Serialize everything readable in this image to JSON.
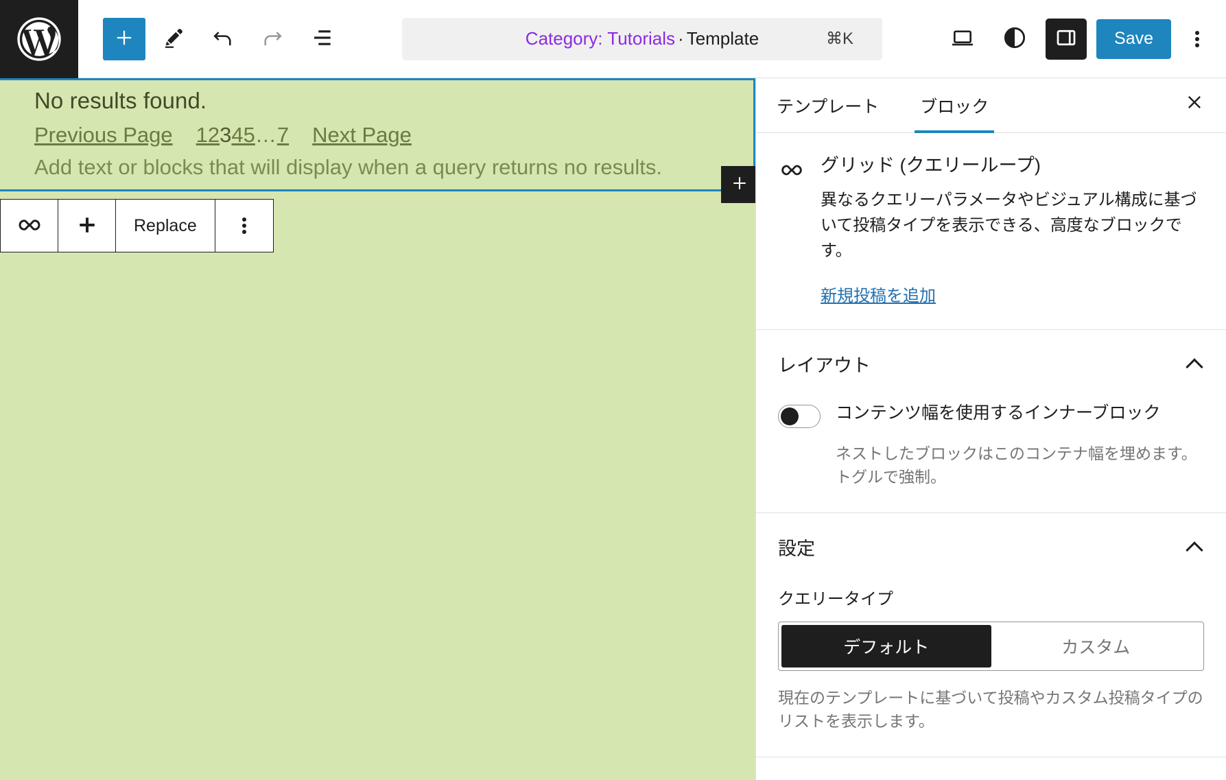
{
  "header": {
    "logo_icon": "wordpress-logo-icon",
    "add_block_icon": "plus-icon",
    "edit_icon": "pencil-icon",
    "undo_icon": "undo-arrow-icon",
    "redo_icon": "redo-arrow-icon",
    "list_view_icon": "list-view-icon",
    "document_title_category": "Category: Tutorials",
    "document_title_separator": "·",
    "document_title_type": "Template",
    "document_shortcut": "⌘K",
    "view_icon": "desktop-view-icon",
    "styles_icon": "contrast-styles-icon",
    "sidebar_toggle_icon": "sidebar-panel-icon",
    "save_label": "Save",
    "options_icon": "kebab-menu-icon"
  },
  "canvas": {
    "no_results_text": "No results found.",
    "pagination": {
      "previous_label": "Previous Page",
      "pages": [
        "1",
        "2",
        "3",
        "4",
        "5"
      ],
      "current_page": "3",
      "dots": "…",
      "last_page": "7",
      "next_label": "Next Page"
    },
    "no_results_placeholder": "Add text or blocks that will display when a query returns no results.",
    "appender_icon": "plus-icon",
    "block_toolbar": {
      "block_type_icon": "query-loop-icon",
      "add_icon": "plus-icon",
      "replace_label": "Replace",
      "options_icon": "kebab-menu-icon"
    }
  },
  "sidebar": {
    "tabs": [
      {
        "label": "テンプレート",
        "active": false
      },
      {
        "label": "ブロック",
        "active": true
      }
    ],
    "close_icon": "close-icon",
    "block_card": {
      "icon": "query-loop-icon",
      "title": "グリッド (クエリーループ)",
      "description": "異なるクエリーパラメータやビジュアル構成に基づいて投稿タイプを表示できる、高度なブロックです。",
      "link_label": "新規投稿を追加"
    },
    "layout_panel": {
      "title": "レイアウト",
      "chevron_icon": "chevron-up-icon",
      "toggle_label": "コンテンツ幅を使用するインナーブロック",
      "toggle_on": false,
      "help_text": "ネストしたブロックはこのコンテナ幅を埋めます。トグルで強制。"
    },
    "settings_panel": {
      "title": "設定",
      "chevron_icon": "chevron-up-icon",
      "query_type_label": "クエリータイプ",
      "query_type_options": [
        "デフォルト",
        "カスタム"
      ],
      "query_type_selected": "デフォルト",
      "help_text": "現在のテンプレートに基づいて投稿やカスタム投稿タイプのリストを表示します。"
    }
  },
  "colors": {
    "accent": "#1e85be",
    "canvas_bg": "#d6e6b0",
    "link": "#2271b1",
    "category_purple": "#8a2be2"
  }
}
